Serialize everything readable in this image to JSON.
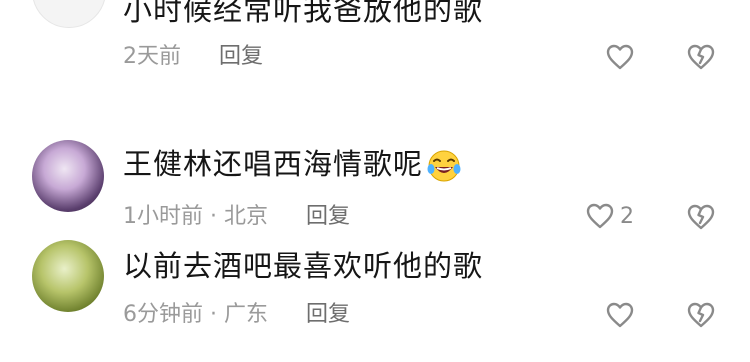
{
  "comments": [
    {
      "text": "小时候经常听我爸放他的歌",
      "time": "2天前",
      "reply_label": "回复",
      "likes": ""
    },
    {
      "text": "王健林还唱西海情歌呢",
      "emoji": "laughing-tears-emoji",
      "time": "1小时前 · 北京",
      "reply_label": "回复",
      "likes": "2"
    },
    {
      "text": "以前去酒吧最喜欢听他的歌",
      "time": "6分钟前 · 广东",
      "reply_label": "回复",
      "likes": ""
    }
  ],
  "icons": {
    "like": "heart-outline-icon",
    "dislike": "broken-heart-icon"
  },
  "colors": {
    "meta": "#9a9a9a",
    "reply": "#6e6e6e",
    "icon": "#8a8a8a"
  }
}
